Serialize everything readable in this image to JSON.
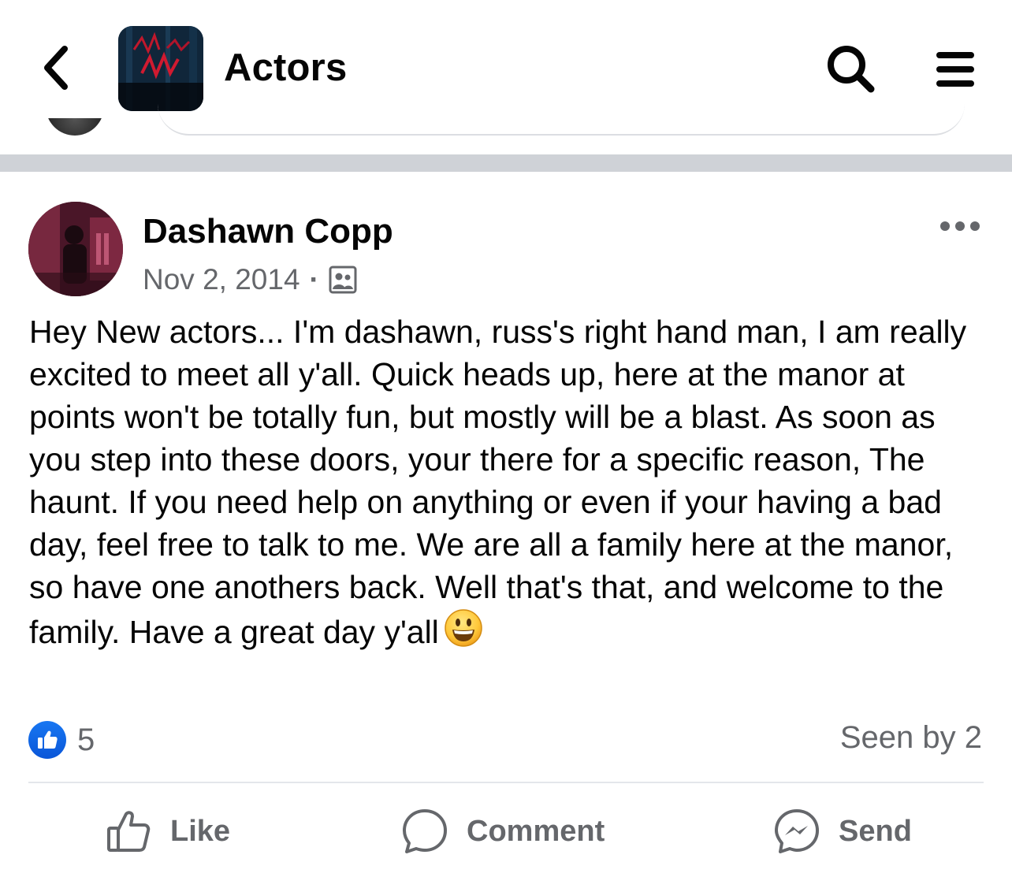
{
  "header": {
    "group_title": "Actors",
    "icons": {
      "back": "chevron-left-icon",
      "search": "search-icon",
      "menu": "hamburger-menu-icon"
    }
  },
  "post": {
    "author": "Dashawn Copp",
    "date": "Nov 2, 2014",
    "separator": "·",
    "audience_icon": "group-members-icon",
    "text": "Hey New actors... I'm dashawn, russ's right hand man, I am really excited to meet all y'all. Quick heads up, here at the manor at points won't be totally fun, but mostly will be a blast. As soon as you step into these doors, your there for a specific reason, The haunt. If you need help on anything or even if your having a bad day, feel free to talk to me. We are all a family here at the manor, so have one anothers back. Well that's that, and welcome to the family. Have a great day y'all",
    "emoji": "grinning-face-emoji",
    "reaction_count": "5",
    "seen_by": "Seen by 2"
  },
  "actions": {
    "like": "Like",
    "comment": "Comment",
    "send": "Send"
  },
  "colors": {
    "accent": "#1877f2",
    "secondary_text": "#65676b",
    "primary_text": "#050505",
    "divider": "#cfd2d7"
  }
}
